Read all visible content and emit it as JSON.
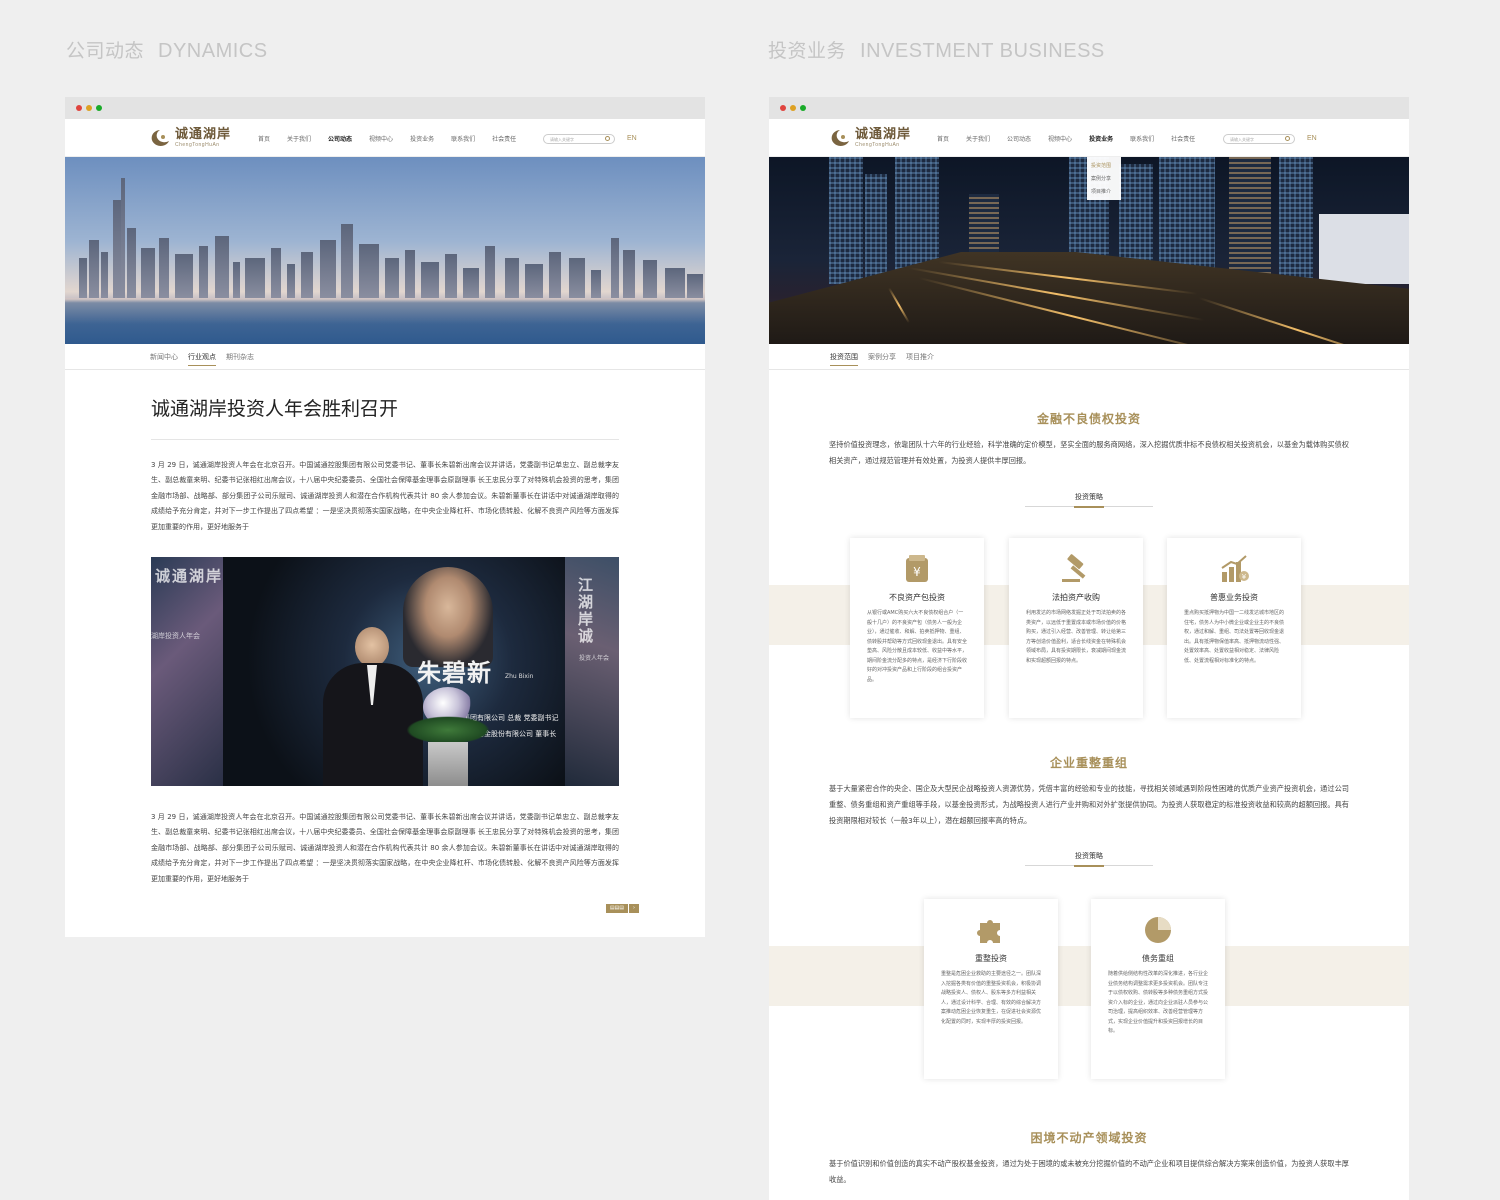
{
  "left_section": {
    "title_cn": "公司动态",
    "title_en": "DYNAMICS"
  },
  "right_section": {
    "title_cn": "投资业务",
    "title_en": "INVESTMENT BUSINESS"
  },
  "logo": {
    "cn": "诚通湖岸",
    "pinyin": "ChengTongHuAn"
  },
  "nav": {
    "items": [
      "首页",
      "关于我们",
      "公司动态",
      "视频中心",
      "投资业务",
      "联系我们",
      "社会责任"
    ],
    "search_placeholder": "请输入关键字",
    "en": "EN"
  },
  "left_page": {
    "subnav": [
      "新闻中心",
      "行业观点",
      "期刊杂志"
    ],
    "article_title": "诚通湖岸投资人年会胜利召开",
    "para1": "3 月 29 日，诚通湖岸投资人年会在北京召开。中国诚通控股集团有限公司党委书记、董事长朱碧新出席会议并讲话，党委副书记单忠立、副总裁李友生、副总裁童来明、纪委书记张相红出席会议，十八届中央纪委委员、全国社会保障基金理事会原副理事 长王忠民分享了对特殊机会投资的思考，集团金融市场部、战略部、部分集团子公司乐赋司、诚通湖岸投资人和潜在合作机构代表共计 80 余人参加会议。朱碧新董事长在讲话中对诚通湖岸取得的成绩给予充分肯定，并对下一步工作提出了四点希望 ：一是坚决贯彻落实国家战略，在中央企业降杠杆、市场化债转股、化解不良资产风险等方面发挥更加重要的作用，更好地服务于",
    "para2": "3 月 29 日，诚通湖岸投资人年会在北京召开。中国诚通控股集团有限公司党委书记、董事长朱碧新出席会议并讲话，党委副书记单忠立、副总裁李友生、副总裁童来明、纪委书记张相红出席会议，十八届中央纪委委员、全国社会保障基金理事会原副理事 长王忠民分享了对特殊机会投资的思考，集团金融市场部、战略部、部分集团子公司乐赋司、诚通湖岸投资人和潜在合作机构代表共计 80 余人参加会议。朱碧新董事长在讲话中对诚通湖岸取得的成绩给予充分肯定，并对下一步工作提出了四点希望 ：一是坚决贯彻落实国家战略，在中央企业降杠杆、市场化债转股、化解不良资产风险等方面发挥更加重要的作用，更好地服务于",
    "photo": {
      "screen_name_cn": "朱碧新",
      "screen_name_en": "Zhu Bixin",
      "screen_line1": "集团有限公司 总裁 党委副书记",
      "screen_line2": "重整基金股份有限公司 董事长",
      "left_panel": "诚通湖岸",
      "left_panel2": "湖岸投资人年会",
      "right_panel": "江湖岸诚",
      "right_panel2": "投资人年会"
    },
    "pager": [
      "▤▤▤",
      "›"
    ]
  },
  "right_page": {
    "dropdown": [
      "投资范围",
      "案例分享",
      "项目推介"
    ],
    "subnav": [
      "投资范围",
      "案例分享",
      "项目推介"
    ],
    "sec1": {
      "title": "金融不良债权投资",
      "desc": "坚持价值投资理念，依靠团队十六年的行业经验，科学准确的定价模型，坚实全面的服务商网络，深入挖掘优质非标不良债权相关投资机会，以基金为载体购买债权相关资产，通过规范管理并有效处置，为投资人提供丰厚回报。",
      "strategy": "投资策略",
      "cards": [
        {
          "icon": "wallet-yuan-icon",
          "title": "不良资产包投资",
          "desc": "从银行或AMC购买六大不良债权组合户（一般十几户）的不良资产包（债务人一般为企业），通过催收、和解、拍卖抵押物、重组、债转股并帮助等方式回收现金退出。具有安全垫高、风险分散且成本较低、收益中等水平，期间阶金流分配多的特点，是经济下行阶段收好的对冲投资产品和上行阶段的组合投资产品。"
        },
        {
          "icon": "gavel-icon",
          "title": "法拍资产收购",
          "desc": "利用发达的市场网络发掘正处于司法拍卖的各类资产，以远低于重置成本或市场价值的价格购买，通过引入经营、改善管理、转让给第三方等创造价值盈利，适合长线资金在特殊机会领域布局，具有投资期限长，衰减期间现金流和实现超额回报的特点。"
        },
        {
          "icon": "bar-chart-yuan-icon",
          "title": "普惠业务投资",
          "desc": "重点购买抵押物为中国一二线发达城市地区的住宅，债务人为中小微企业或企业主的不良债权，通过和解、重组、司法处置等回收现金退出。具有抵押物保值率高、抵押物流动性强、处置效率高、处置收益相对稳定、法律风险低、处置流程相对标准化的特点。"
        }
      ]
    },
    "sec2": {
      "title": "企业重整重组",
      "desc": "基于大量紧密合作的央企、国企及大型民企战略投资人资源优势，凭借丰富的经验和专业的技能，寻找相关领域遇到阶段性困难的优质产业资产投资机会，通过公司重整、债务重组和资产重组等手段，以基金投资形式，为战略投资人进行产业并购和对外扩张提供协同。为投资人获取稳定的标准投资收益和较高的超额回报。具有投资期限相对较长（一般3年以上），潜在超额回报率高的特点。",
      "strategy": "投资策略",
      "cards": [
        {
          "icon": "puzzle-icon",
          "title": "重整投资",
          "desc": "重整是危困企业救助的主要途径之一。团队深入挖掘各类有价值的重整投资机会，积极协调战略投资人、债权人、股东等多方利益相关人，通过设计科学、合理、有效的综合解决方案推动危困企业恢复重生，在促进社会资源优化配置的同时，实现丰厚的投资回报。"
        },
        {
          "icon": "pie-chart-icon",
          "title": "债务重组",
          "desc": "随着供给侧结构性改革的深化推进，各行业企业债务结构调整需求更多投资机会。团队专注于以债权收购、债转股等多种债务重组方式投资介入标的企业，通过向企业派驻人员参与公司治理，提高组织效率、改善经营管理等方式，实现企业价值提升和投资回报增长的目标。"
        }
      ]
    },
    "sec3": {
      "title": "困境不动产领域投资",
      "desc": "基于价值识别和价值创造的真实不动产股权基金投资，通过为处于困境的或未被充分挖掘价值的不动产企业和项目提供综合解决方案来创造价值，为投资人获取丰厚收益。"
    }
  },
  "colors": {
    "accent": "#a8905a",
    "background": "#efefef",
    "band": "#f4f0e8"
  }
}
